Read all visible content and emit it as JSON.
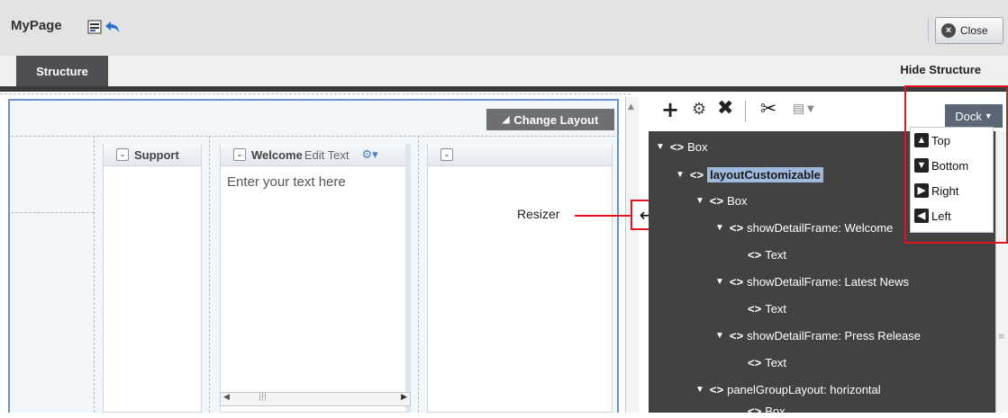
{
  "header": {
    "title": "MyPage",
    "close_label": "Close"
  },
  "tabs": {
    "structure": "Structure",
    "hide_structure": "Hide Structure"
  },
  "canvas": {
    "change_layout": "Change Layout",
    "columns": [
      {
        "title": "Support"
      },
      {
        "title_bold": "Welcome",
        "title_extra": "Edit Text"
      },
      {
        "title": ""
      }
    ],
    "placeholder": "Enter your text here"
  },
  "resizer": {
    "label": "Resizer"
  },
  "dock": {
    "button": "Dock",
    "menu": [
      "Top",
      "Bottom",
      "Right",
      "Left"
    ]
  },
  "tree": [
    {
      "tag": "<>",
      "label": "Box",
      "indent": 0,
      "expanded": true
    },
    {
      "tag": "<>",
      "label": "layoutCustomizable",
      "indent": 1,
      "expanded": true,
      "selected": true
    },
    {
      "tag": "<>",
      "label": "Box",
      "indent": 2,
      "expanded": true
    },
    {
      "tag": "<>",
      "label": "showDetailFrame: Welcome",
      "indent": 3,
      "expanded": true
    },
    {
      "tag": "<>",
      "label": "Text",
      "indent": 4,
      "expanded": false
    },
    {
      "tag": "<>",
      "label": "showDetailFrame: Latest News",
      "indent": 3,
      "expanded": true
    },
    {
      "tag": "<>",
      "label": "Text",
      "indent": 4,
      "expanded": false
    },
    {
      "tag": "<>",
      "label": "showDetailFrame: Press Release",
      "indent": 3,
      "expanded": true
    },
    {
      "tag": "<>",
      "label": "Text",
      "indent": 4,
      "expanded": false
    },
    {
      "tag": "<>",
      "label": "panelGroupLayout: horizontal",
      "indent": 2,
      "expanded": true
    },
    {
      "tag": "<>",
      "label": "Box",
      "indent": 3,
      "expanded": false
    }
  ],
  "colors": {
    "accent_red": "#e0141e",
    "tree_bg": "#424242",
    "selection": "#9fb9dd"
  }
}
